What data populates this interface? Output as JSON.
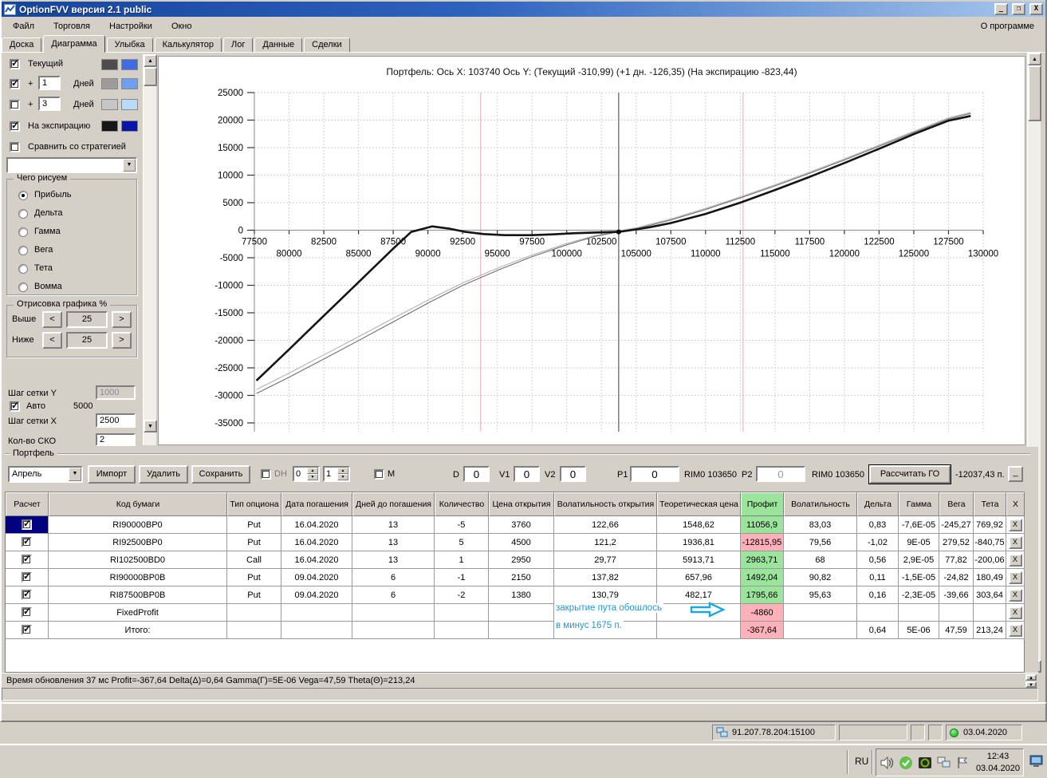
{
  "window": {
    "title": "OptionFVV версия 2.1 public",
    "min": "_",
    "max": "❐",
    "close": "X"
  },
  "menu": {
    "items": [
      "Файл",
      "Торговля",
      "Настройки",
      "Окно"
    ],
    "right": "О программе"
  },
  "tabs": {
    "items": [
      "Доска",
      "Диаграмма",
      "Улыбка",
      "Калькулятор",
      "Лог",
      "Данные",
      "Сделки"
    ],
    "active_index": 1
  },
  "side_panel": {
    "lines": [
      {
        "label": "Текущий",
        "checked": true,
        "sw1": "#4d4d4d",
        "sw2": "#3f6ce0"
      },
      {
        "prefix": "+",
        "value": "1",
        "label": "Дней",
        "checked": true,
        "sw1": "#9c9c9c",
        "sw2": "#6f9ff0"
      },
      {
        "prefix": "+",
        "value": "3",
        "label": "Дней",
        "checked": false,
        "sw1": "#c6c6c6",
        "sw2": "#b8dcf6"
      },
      {
        "label": "На экспирацию",
        "checked": true,
        "sw1": "#161616",
        "sw2": "#0a14aa"
      },
      {
        "label": "Сравнить со стратегией",
        "checked": false
      }
    ],
    "strategy_dropdown_value": "",
    "draw_group": {
      "title": "Чего рисуем",
      "options": [
        "Прибыль",
        "Дельта",
        "Гамма",
        "Вега",
        "Тета",
        "Вомма"
      ],
      "selected": "Прибыль"
    },
    "render_group": {
      "title": "Отрисовка графика %",
      "rows": [
        {
          "label": "Выше",
          "value": "25"
        },
        {
          "label": "Ниже",
          "value": "25"
        }
      ],
      "dec": "<",
      "inc": ">"
    },
    "grid": {
      "y_label": "Шаг сетки Y",
      "y_value": "1000",
      "auto_label": "Авто",
      "auto_checked": true,
      "auto_value": "5000",
      "x_label": "Шаг сетки X",
      "x_value": "2500",
      "sko_label": "Кол-во СКО",
      "sko_value": "2"
    }
  },
  "chart_data": {
    "type": "line",
    "title": "Портфель: Ось X: 103740 Ось Y:   (Текущий -310,99)   (+1 дн. -126,35)   (На экспирацию -823,44)",
    "x_range": [
      77500,
      130000
    ],
    "y_range": [
      -35000,
      25000
    ],
    "y_ticks": [
      25000,
      20000,
      15000,
      10000,
      5000,
      0,
      -5000,
      -10000,
      -15000,
      -20000,
      -25000,
      -30000,
      -35000
    ],
    "x_ticks_row1": [
      77500,
      82500,
      87500,
      92500,
      97500,
      102500,
      107500,
      112500,
      117500,
      122500,
      127500
    ],
    "x_ticks_row2": [
      80000,
      85000,
      90000,
      95000,
      100000,
      105000,
      110000,
      115000,
      120000,
      125000,
      130000
    ],
    "x_grid_step": 2500,
    "y_grid_step": 5000,
    "grid": true,
    "crosshair_x": 103740,
    "sd_lines": [
      93800,
      112700
    ],
    "marker": {
      "x": 103740,
      "y": -311
    },
    "series": [
      {
        "name": "+1 Дней",
        "color": "#b2b2b2",
        "width": 1.1,
        "points": [
          [
            77650,
            -28950
          ],
          [
            80000,
            -25950
          ],
          [
            82500,
            -22650
          ],
          [
            85000,
            -19350
          ],
          [
            87500,
            -16000
          ],
          [
            90000,
            -12700
          ],
          [
            92500,
            -9600
          ],
          [
            95000,
            -6900
          ],
          [
            97500,
            -4500
          ],
          [
            100000,
            -2400
          ],
          [
            102000,
            -1000
          ],
          [
            103740,
            -126
          ],
          [
            105000,
            450
          ],
          [
            107500,
            2050
          ],
          [
            110000,
            3950
          ],
          [
            112500,
            6050
          ],
          [
            115000,
            8250
          ],
          [
            117500,
            10550
          ],
          [
            120000,
            12950
          ],
          [
            122500,
            15450
          ],
          [
            125000,
            17950
          ],
          [
            127500,
            20400
          ],
          [
            129100,
            21400
          ]
        ]
      },
      {
        "name": "Текущий",
        "color": "#6e6e6e",
        "width": 1.1,
        "points": [
          [
            77650,
            -29650
          ],
          [
            80000,
            -26700
          ],
          [
            82500,
            -23400
          ],
          [
            85000,
            -20050
          ],
          [
            87500,
            -16650
          ],
          [
            90000,
            -13250
          ],
          [
            92500,
            -10050
          ],
          [
            95000,
            -7300
          ],
          [
            97500,
            -4800
          ],
          [
            100000,
            -2650
          ],
          [
            102000,
            -1150
          ],
          [
            103740,
            -311
          ],
          [
            105000,
            250
          ],
          [
            107500,
            1850
          ],
          [
            110000,
            3750
          ],
          [
            112500,
            5850
          ],
          [
            115000,
            8050
          ],
          [
            117500,
            10350
          ],
          [
            120000,
            12750
          ],
          [
            122500,
            15250
          ],
          [
            125000,
            17750
          ],
          [
            127500,
            20200
          ],
          [
            129100,
            21200
          ]
        ]
      },
      {
        "name": "На экспирацию",
        "color": "#141414",
        "width": 2.6,
        "points": [
          [
            77650,
            -27300
          ],
          [
            80000,
            -21650
          ],
          [
            82500,
            -15550
          ],
          [
            85000,
            -9450
          ],
          [
            87500,
            -3350
          ],
          [
            88800,
            -300
          ],
          [
            90300,
            700
          ],
          [
            91500,
            300
          ],
          [
            92700,
            -300
          ],
          [
            94000,
            -700
          ],
          [
            95500,
            -900
          ],
          [
            97500,
            -900
          ],
          [
            99000,
            -750
          ],
          [
            100500,
            -550
          ],
          [
            102000,
            -420
          ],
          [
            103740,
            -300
          ],
          [
            104600,
            0
          ],
          [
            106000,
            550
          ],
          [
            107500,
            1300
          ],
          [
            110000,
            2950
          ],
          [
            112500,
            5000
          ],
          [
            115000,
            7300
          ],
          [
            117500,
            9700
          ],
          [
            120000,
            12200
          ],
          [
            122500,
            14800
          ],
          [
            125000,
            17450
          ],
          [
            127500,
            19900
          ],
          [
            129100,
            20750
          ]
        ]
      }
    ]
  },
  "portfolio": {
    "group_label": "Портфель",
    "toolbar": {
      "month": "Апрель",
      "import": "Импорт",
      "delete": "Удалить",
      "save": "Сохранить",
      "dh": "DH",
      "spin1": "0",
      "spin2": "1",
      "m": "М",
      "d": "D",
      "d_value": "0",
      "v1": "V1",
      "v1_value": "0",
      "v2": "V2",
      "v2_value": "0",
      "p1": "P1",
      "p1_value": "0",
      "rim1": "RIM0 103650",
      "p2": "P2",
      "p2_value": "0",
      "rim2": "RIM0 103650",
      "calc": "Рассчитать ГО",
      "go_value": "-12037,43 п.",
      "collapse": "_"
    },
    "table": {
      "headers": [
        "Расчет",
        "Код бумаги",
        "Тип опциона",
        "Дата погашения",
        "Дней до погашения",
        "Количество",
        "Цена открытия",
        "Волатильность открытия",
        "Теоретическая цена",
        "Профит",
        "Волатильность",
        "Дельта",
        "Гамма",
        "Вега",
        "Тета",
        "X"
      ],
      "delete_label": "X",
      "rows": [
        {
          "checked": true,
          "selected": true,
          "profit_color": "green",
          "cells": [
            "RI90000BP0",
            "Put",
            "16.04.2020",
            "13",
            "-5",
            "3760",
            "122,66",
            "1548,62",
            "11056,9",
            "83,03",
            "0,83",
            "-7,6E-05",
            "-245,27",
            "769,92"
          ]
        },
        {
          "checked": true,
          "profit_color": "red",
          "cells": [
            "RI92500BP0",
            "Put",
            "16.04.2020",
            "13",
            "5",
            "4500",
            "121,2",
            "1936,81",
            "-12815,95",
            "79,56",
            "-1,02",
            "9E-05",
            "279,52",
            "-840,75"
          ]
        },
        {
          "checked": true,
          "profit_color": "green",
          "cells": [
            "RI102500BD0",
            "Call",
            "16.04.2020",
            "13",
            "1",
            "2950",
            "29,77",
            "5913,71",
            "2963,71",
            "68",
            "0,56",
            "2,9E-05",
            "77,82",
            "-200,06"
          ]
        },
        {
          "checked": true,
          "profit_color": "green",
          "cells": [
            "RI90000BP0B",
            "Put",
            "09.04.2020",
            "6",
            "-1",
            "2150",
            "137,82",
            "657,96",
            "1492,04",
            "90,82",
            "0,11",
            "-1,5E-05",
            "-24,82",
            "180,49"
          ]
        },
        {
          "checked": true,
          "profit_color": "green",
          "cells": [
            "RI87500BP0B",
            "Put",
            "09.04.2020",
            "6",
            "-2",
            "1380",
            "130,79",
            "482,17",
            "1795,66",
            "95,63",
            "0,16",
            "-2,3E-05",
            "-39,66",
            "303,64"
          ]
        },
        {
          "checked": true,
          "profit_color": "red",
          "cells": [
            "FixedProfit",
            "",
            "",
            "",
            "",
            "",
            "",
            "",
            "-4860",
            "",
            "",
            "",
            "",
            ""
          ]
        },
        {
          "checked": true,
          "profit_color": "red",
          "cells": [
            "Итого:",
            "",
            "",
            "",
            "",
            "",
            "",
            "",
            "-367,64",
            "",
            "0,64",
            "5E-06",
            "47,59",
            "213,24"
          ]
        }
      ]
    },
    "annotation": {
      "line1": "закрытие пута обошлось",
      "line2": "в минус 1675 п.",
      "color": "#1b9ad2"
    }
  },
  "status_bar": {
    "text": "Время обновления 37 мс  Profit=-367,64 Delta(Δ)=0,64 Gamma(Г)=5E-06 Vega=47,59 Theta(Θ)=213,24"
  },
  "footer": {
    "ip": "91.207.78.204:15100",
    "date": "03.04.2020"
  },
  "taskbar": {
    "lang": "RU",
    "time": "12:43",
    "date": "03.04.2020"
  }
}
